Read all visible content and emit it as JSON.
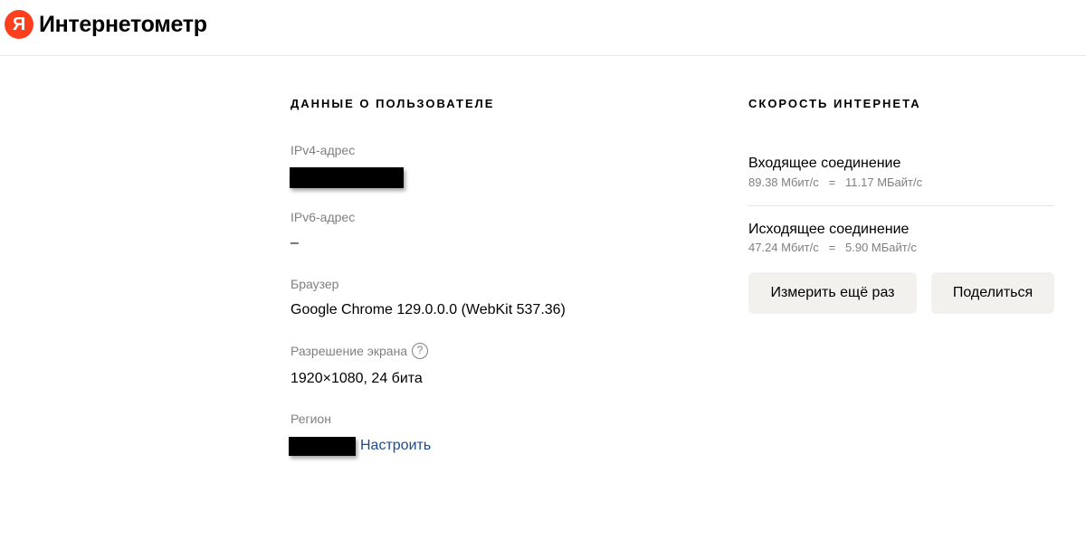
{
  "header": {
    "logo_letter": "Я",
    "title": "Интернетометр"
  },
  "user": {
    "title": "ДАННЫЕ О ПОЛЬЗОВАТЕЛЕ",
    "ipv4_label": "IPv4-адрес",
    "ipv6_label": "IPv6-адрес",
    "ipv6_value": "–",
    "browser_label": "Браузер",
    "browser_value": "Google Chrome 129.0.0.0 (WebKit 537.36)",
    "screen_label": "Разрешение экрана",
    "screen_help": "?",
    "screen_value": "1920×1080, 24 бита",
    "region_label": "Регион",
    "region_link": "Настроить"
  },
  "speed": {
    "title": "СКОРОСТЬ ИНТЕРНЕТА",
    "download_title": "Входящее соединение",
    "download_value": "89.38 Мбит/с   =   11.17 МБайт/с",
    "upload_title": "Исходящее соединение",
    "upload_value": "47.24 Мбит/с   =   5.90 МБайт/с",
    "remeasure_button": "Измерить ещё раз",
    "share_button": "Поделиться"
  }
}
